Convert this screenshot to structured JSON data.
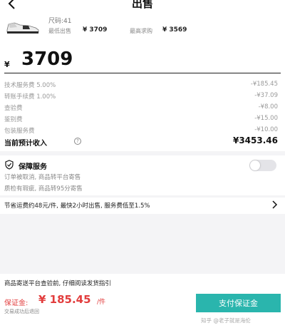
{
  "header": {
    "title": "出售",
    "back_icon": "chevron-left-icon"
  },
  "product": {
    "image_icon": "sneaker-icon",
    "size": "尺码:41",
    "lowest_label": "最低出售",
    "lowest_value": "¥ 3709",
    "highest_label": "最高求购",
    "highest_value": "¥ 3569"
  },
  "price": {
    "currency": "¥",
    "value": "3709"
  },
  "fees": [
    {
      "label": "技术服务费 5.00%",
      "value": "-¥185.45"
    },
    {
      "label": "转账手续费 1.00%",
      "value": "-¥37.09"
    },
    {
      "label": "查验费",
      "value": "-¥8.00"
    },
    {
      "label": "鉴别费",
      "value": "-¥15.00"
    },
    {
      "label": "包装服务费",
      "value": "-¥10.00"
    }
  ],
  "income": {
    "label": "当前预计收入",
    "help_icon": "?",
    "value": "¥3453.46"
  },
  "guarantee": {
    "title": "保障服务",
    "icon": "shield-icon",
    "line1": "订单被取消, 商品转平台寄售",
    "line2": "质检有瑕疵, 商品转95分寄售",
    "toggle_on": false
  },
  "promo": {
    "text": "节省运费约48元/件, 最快2小时出售, 服务费低至1.5%"
  },
  "guide": {
    "text": "商品寄送平台查验前, 仔细阅读发货指引"
  },
  "footer": {
    "deposit_label": "保证金:",
    "deposit_value": "¥ 185.45",
    "deposit_unit": "/件",
    "refund_note": "交易成功后退回",
    "pay_label": "支付保证金",
    "watermark": "知乎 @老子就是海伦"
  },
  "colors": {
    "accent": "#2ab5ad",
    "price_red": "#e23d3d"
  }
}
